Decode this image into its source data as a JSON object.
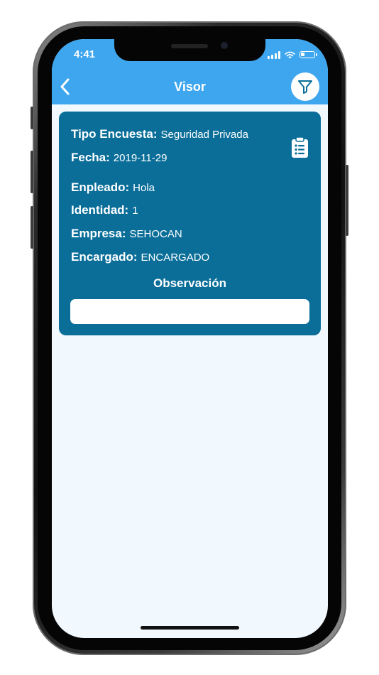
{
  "status_bar": {
    "time": "4:41"
  },
  "header": {
    "title": "Visor"
  },
  "card": {
    "fields": [
      {
        "label": "Tipo Encuesta:",
        "value": "Seguridad Privada"
      },
      {
        "label": "Fecha:",
        "value": "2019-11-29"
      },
      {
        "label": "Enpleado:",
        "value": "Hola"
      },
      {
        "label": "Identidad:",
        "value": "1"
      },
      {
        "label": "Empresa:",
        "value": "SEHOCAN"
      },
      {
        "label": "Encargado:",
        "value": "ENCARGADO"
      }
    ],
    "observation_title": "Observación",
    "observation_value": ""
  },
  "colors": {
    "header": "#3da6ef",
    "card": "#0a6e99",
    "background": "#f2f9fe"
  },
  "icons": {
    "back": "chevron-left-icon",
    "filter": "filter-icon",
    "clipboard": "clipboard-list-icon"
  }
}
